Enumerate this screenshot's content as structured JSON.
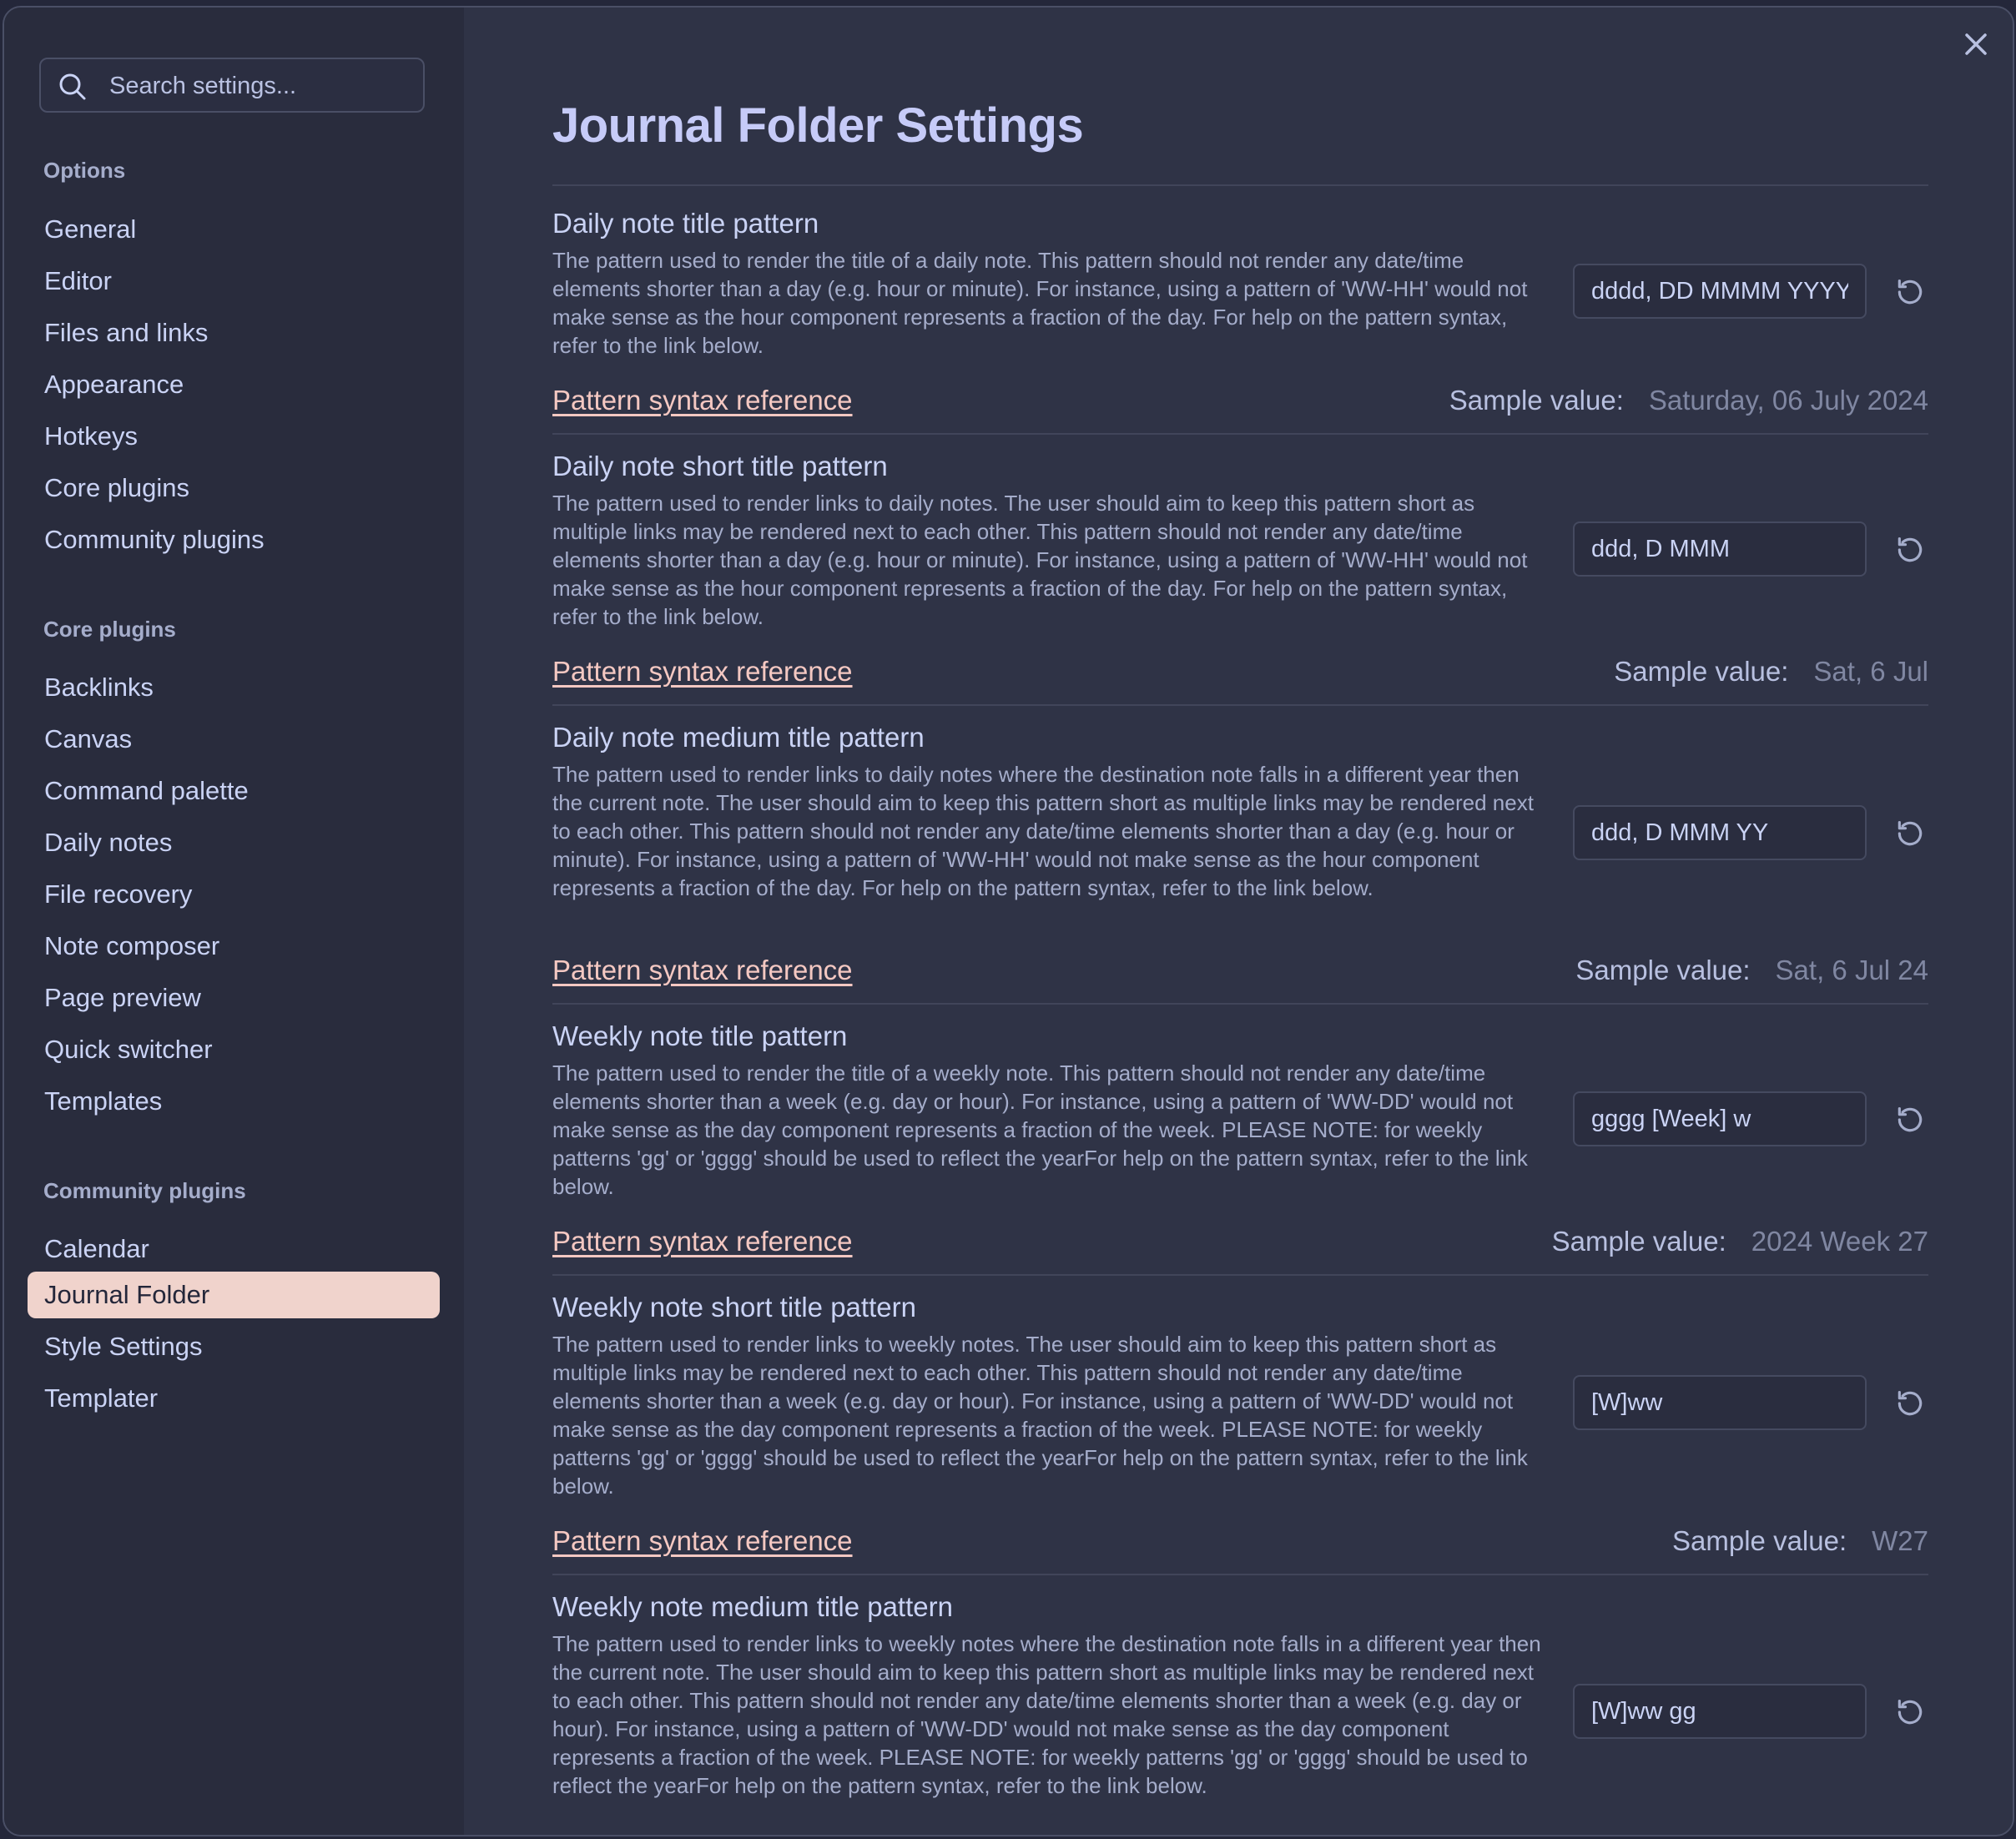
{
  "search": {
    "placeholder": "Search settings..."
  },
  "sidebar": {
    "groups": [
      {
        "label": "Options",
        "items": [
          "General",
          "Editor",
          "Files and links",
          "Appearance",
          "Hotkeys",
          "Core plugins",
          "Community plugins"
        ]
      },
      {
        "label": "Core plugins",
        "items": [
          "Backlinks",
          "Canvas",
          "Command palette",
          "Daily notes",
          "File recovery",
          "Note composer",
          "Page preview",
          "Quick switcher",
          "Templates"
        ]
      },
      {
        "label": "Community plugins",
        "items": [
          "Calendar",
          "Journal Folder",
          "Style Settings",
          "Templater"
        ]
      }
    ],
    "active_item": "Journal Folder"
  },
  "main": {
    "title": "Journal Folder Settings",
    "reference_link_label": "Pattern syntax reference",
    "sample_label": "Sample value:",
    "settings": [
      {
        "name": "Daily note title pattern",
        "description": "The pattern used to render the title of a daily note. This pattern should not render any date/time elements shorter than a day (e.g. hour or minute). For instance, using a pattern of 'WW-HH' would not make sense as the hour component represents a fraction of the day. For help on the pattern syntax, refer to the link below.",
        "value": "dddd, DD MMMM YYYY",
        "sample": "Saturday, 06 July 2024"
      },
      {
        "name": "Daily note short title pattern",
        "description": "The pattern used to render links to daily notes. The user should aim to keep this pattern short as multiple links may be rendered next to each other. This pattern should not render any date/time elements shorter than a day (e.g. hour or minute). For instance, using a pattern of 'WW-HH' would not make sense as the hour component represents a fraction of the day. For help on the pattern syntax, refer to the link below.",
        "value": "ddd, D MMM",
        "sample": "Sat, 6 Jul"
      },
      {
        "name": "Daily note medium title pattern",
        "description": "The pattern used to render links to daily notes where the destination note falls in a different year then the current note. The user should aim to keep this pattern short as multiple links may be rendered next to each other. This pattern should not render any date/time elements shorter than a day (e.g. hour or minute). For instance, using a pattern of 'WW-HH' would not make sense as the hour component represents a fraction of the day. For help on the pattern syntax, refer to the link below.",
        "value": "ddd, D MMM YY",
        "sample": "Sat, 6 Jul 24"
      },
      {
        "name": "Weekly note title pattern",
        "description": "The pattern used to render the title of a weekly note. This pattern should not render any date/time elements shorter than a week (e.g. day or hour). For instance, using a pattern of 'WW-DD' would not make sense as the day component represents a fraction of the week. PLEASE NOTE: for weekly patterns 'gg' or 'gggg' should be used to reflect the yearFor help on the pattern syntax, refer to the link below.",
        "value": "gggg [Week] w",
        "sample": "2024 Week 27"
      },
      {
        "name": "Weekly note short title pattern",
        "description": "The pattern used to render links to weekly notes. The user should aim to keep this pattern short as multiple links may be rendered next to each other. This pattern should not render any date/time elements shorter than a week (e.g. day or hour). For instance, using a pattern of 'WW-DD' would not make sense as the day component represents a fraction of the week. PLEASE NOTE: for weekly patterns 'gg' or 'gggg' should be used to reflect the yearFor help on the pattern syntax, refer to the link below.",
        "value": "[W]ww",
        "sample": "W27"
      },
      {
        "name": "Weekly note medium title pattern",
        "description": "The pattern used to render links to weekly notes where the destination note falls in a different year then the current note. The user should aim to keep this pattern short as multiple links may be rendered next to each other. This pattern should not render any date/time elements shorter than a week (e.g. day or hour). For instance, using a pattern of 'WW-DD' would not make sense as the day component represents a fraction of the week. PLEASE NOTE: for weekly patterns 'gg' or 'gggg' should be used to reflect the yearFor help on the pattern syntax, refer to the link below.",
        "value": "[W]ww gg"
      }
    ]
  },
  "colors": {
    "background": "#2f3346",
    "sidebar_background": "#292c3d",
    "active_item_background": "#f0d3cc",
    "link": "#f4c8c2",
    "title": "#c6cbf8"
  },
  "icons": {
    "search": "search-icon",
    "close": "close-icon",
    "reset": "reset-icon"
  }
}
